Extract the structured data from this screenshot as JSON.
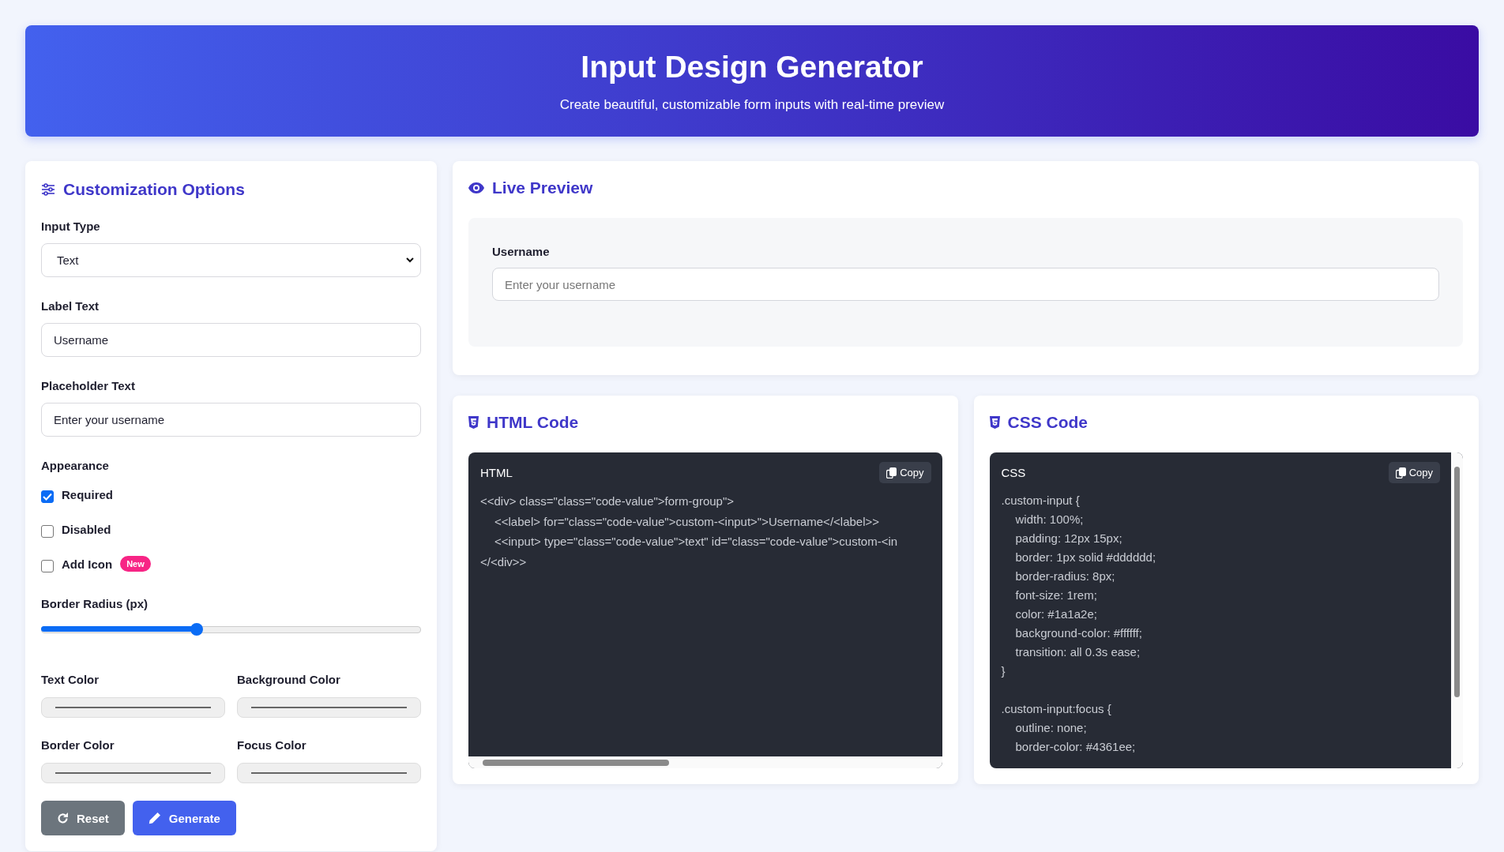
{
  "header": {
    "title": "Input Design Generator",
    "subtitle": "Create beautiful, customizable form inputs with real-time preview"
  },
  "options": {
    "title": "Customization Options",
    "fields": [
      {
        "kind": "select",
        "label": "Input Type",
        "value": "Text"
      },
      {
        "kind": "text",
        "label": "Label Text",
        "value": "Username"
      },
      {
        "kind": "text",
        "label": "Placeholder Text",
        "value": "Enter your username"
      }
    ],
    "appearance": {
      "label": "Appearance",
      "options": [
        {
          "label": "Required",
          "checked": true
        },
        {
          "label": "Disabled",
          "checked": false
        },
        {
          "label": "Add Icon",
          "checked": false,
          "badge": "New"
        }
      ]
    },
    "border_radius": {
      "label": "Border Radius (px)",
      "level": 0.41
    },
    "colors": [
      {
        "label": "Text Color"
      },
      {
        "label": "Background Color"
      },
      {
        "label": "Border Color"
      },
      {
        "label": "Focus Color"
      }
    ],
    "buttons": [
      {
        "label": "Reset",
        "kind": "reset"
      },
      {
        "label": "Generate",
        "kind": "generate"
      }
    ]
  },
  "preview": {
    "title": "Live Preview",
    "field_label": "Username",
    "placeholder": "Enter your username"
  },
  "code_panels": [
    {
      "kind": "html",
      "title": "HTML Code",
      "lang": "HTML",
      "copy": "Copy",
      "lines": [
        {
          "text": "<<div> class=\"class=\"code-value\">form-group\">",
          "indented": false
        },
        {
          "text": "<<label> for=\"class=\"code-value\">custom-<input>\">Username</<label>>",
          "indented": true
        },
        {
          "text": "<<input> type=\"class=\"code-value\">text\" id=\"class=\"code-value\">custom-<in",
          "indented": true
        },
        {
          "text": "</<div>>",
          "indented": false
        }
      ]
    },
    {
      "kind": "css",
      "title": "CSS Code",
      "lang": "CSS",
      "copy": "Copy",
      "blocks": [
        {
          "selector": ".custom-input {",
          "props": [
            "width: 100%;",
            "padding: 12px 15px;",
            "border: 1px solid #dddddd;",
            "border-radius: 8px;",
            "font-size: 1rem;",
            "color: #1a1a2e;",
            "background-color: #ffffff;",
            "transition: all 0.3s ease;"
          ],
          "close": "}"
        },
        {
          "selector": ".custom-input:focus {",
          "props": [
            "outline: none;",
            "border-color: #4361ee;"
          ]
        }
      ]
    }
  ]
}
